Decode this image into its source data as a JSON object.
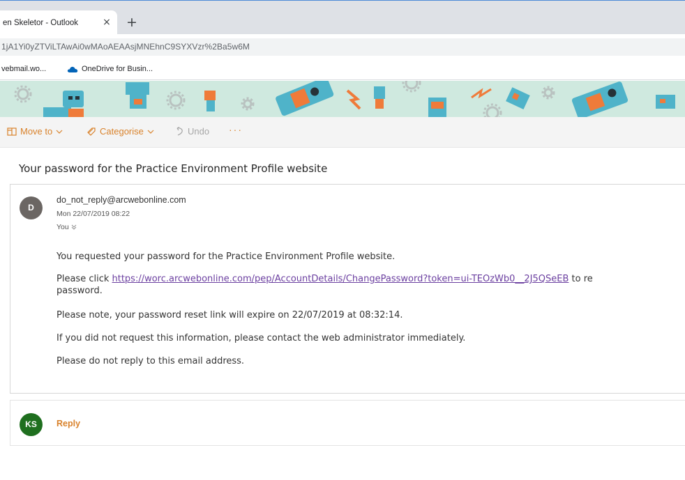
{
  "browser": {
    "tab_title": "en Skeletor - Outlook",
    "tab_close": "×",
    "new_tab": "+",
    "url": "1jA1Yi0yZTViLTAwAi0wMAoAEAAsjMNEhnC9SYXVzr%2Ba5w6M",
    "bookmarks": [
      {
        "label": "vebmail.wo..."
      },
      {
        "label": "OneDrive for Busin..."
      }
    ]
  },
  "commands": {
    "move_to": "Move to",
    "categorise": "Categorise",
    "undo": "Undo",
    "more": "···"
  },
  "message": {
    "subject": "Your password for the Practice Environment Profile website",
    "avatar_initial": "D",
    "sender": "do_not_reply@arcwebonline.com",
    "date": "Mon 22/07/2019 08:22",
    "recipient": "You",
    "body": {
      "line1": "You requested your password for the Practice Environment Profile website.",
      "line2_prefix": "Please click ",
      "link": "https://worc.arcwebonline.com/pep/AccountDetails/ChangePassword?token=ui-TEOzWb0__2J5QSeEB",
      "line2_suffix": " to re",
      "line2_wrap": "password.",
      "line3": "Please note, your password reset link will expire on 22/07/2019 at 08:32:14.",
      "line4": "If you did not request this information, please contact the web administrator immediately.",
      "line5": "Please do not reply to this email address."
    }
  },
  "reply": {
    "avatar_initials": "KS",
    "label": "Reply"
  },
  "colors": {
    "accent": "#d9822b",
    "link": "#6b3fa0",
    "banner_bg": "#cfe9df",
    "sender_avatar": "#6b6663",
    "user_avatar": "#1f6f1f"
  }
}
